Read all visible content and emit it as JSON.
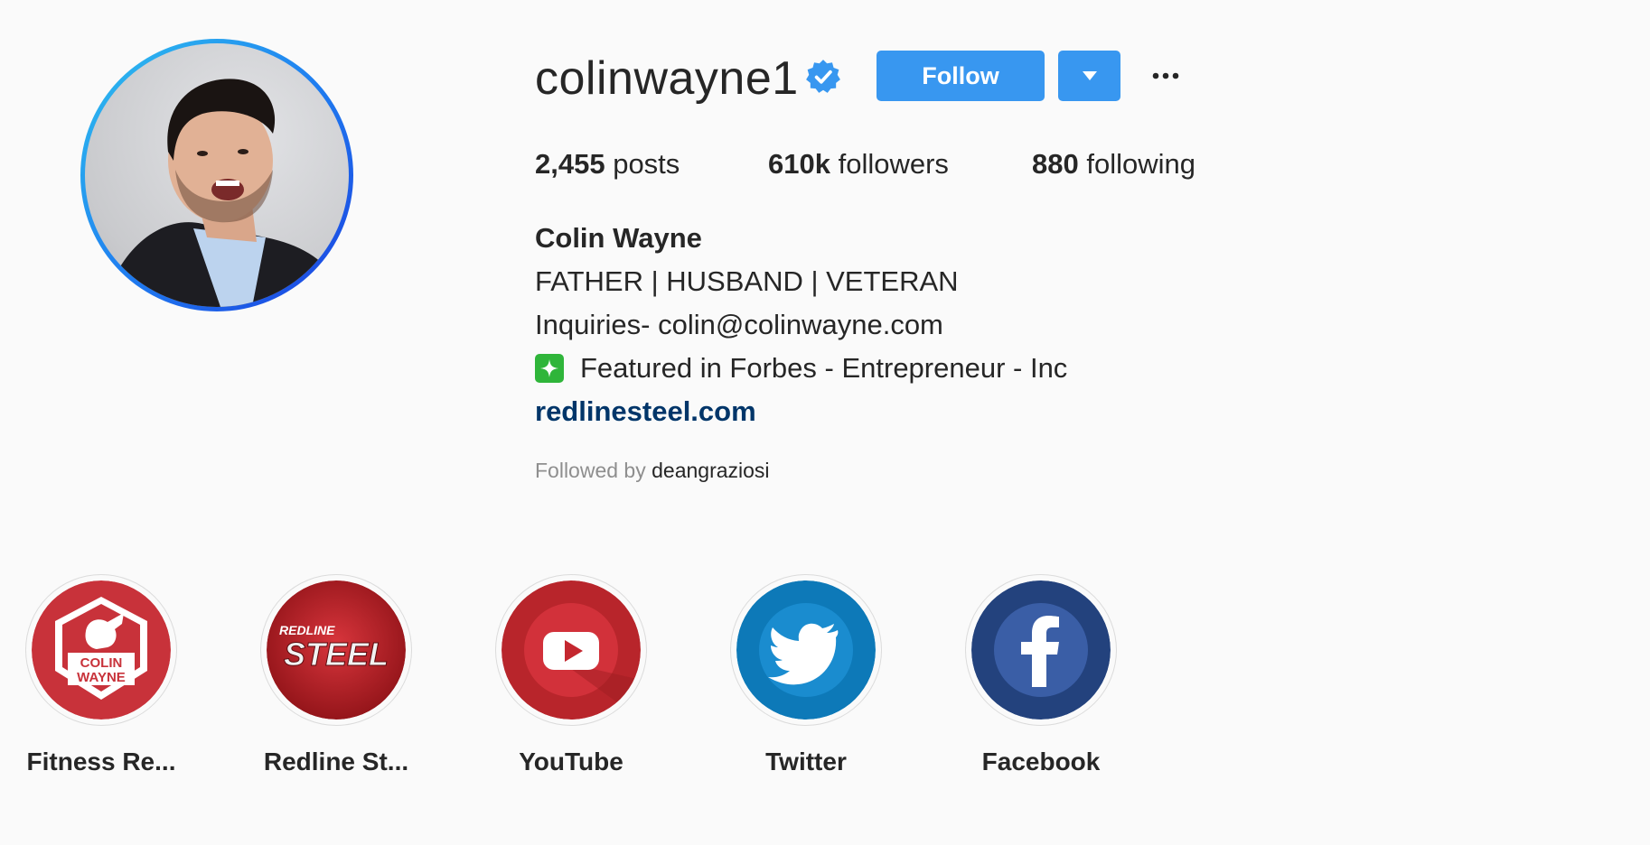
{
  "profile": {
    "username": "colinwayne1",
    "follow_label": "Follow",
    "verified": true,
    "avatar_icon": "profile-photo",
    "stats": {
      "posts_count": "2,455",
      "posts_label": "posts",
      "followers_count": "610k",
      "followers_label": "followers",
      "following_count": "880",
      "following_label": "following"
    },
    "full_name": "Colin Wayne",
    "bio_lines": [
      "FATHER | HUSBAND | VETERAN",
      "Inquiries- colin@colinwayne.com",
      "Featured in Forbes - Entrepreneur - Inc"
    ],
    "website": "redlinesteel.com",
    "followed_by_prefix": "Followed by",
    "followed_by_user": "deangraziosi"
  },
  "highlights": [
    {
      "label": "Fitness Re...",
      "icon": "colin-wayne-logo",
      "logo_text": [
        "COLIN",
        "WAYNE"
      ]
    },
    {
      "label": "Redline St...",
      "icon": "redline-steel-logo",
      "logo_text": [
        "REDLINE",
        "STEEL"
      ]
    },
    {
      "label": "YouTube",
      "icon": "youtube-icon"
    },
    {
      "label": "Twitter",
      "icon": "twitter-icon"
    },
    {
      "label": "Facebook",
      "icon": "facebook-icon"
    }
  ],
  "colors": {
    "follow_button": "#3897f0",
    "link": "#003569",
    "verified_badge": "#3897f0",
    "sparkle_badge": "#2fb53a"
  }
}
